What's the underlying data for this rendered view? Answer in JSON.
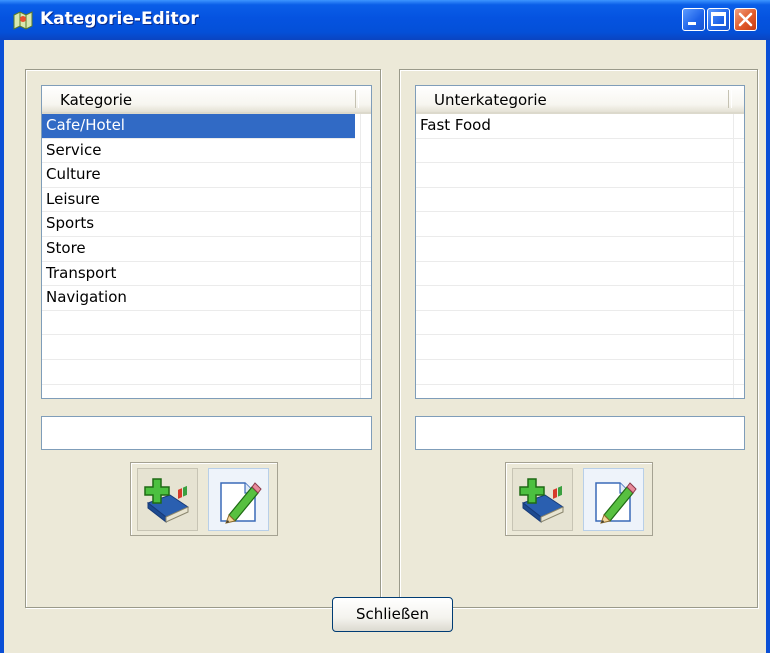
{
  "window": {
    "title": "Kategorie-Editor",
    "icon": "category-map-icon"
  },
  "title_buttons": [
    "minimize-icon",
    "maximize-icon",
    "close-icon"
  ],
  "left_panel": {
    "header": "Kategorie",
    "items": [
      "Cafe/Hotel",
      "Service",
      "Culture",
      "Leisure",
      "Sports",
      "Store",
      "Transport",
      "Navigation"
    ],
    "selected_index": 0,
    "input_value": "",
    "tools": [
      "add-book-icon",
      "edit-pencil-icon"
    ]
  },
  "right_panel": {
    "header": "Unterkategorie",
    "items": [
      "Fast Food"
    ],
    "input_value": "",
    "tools": [
      "add-book-icon",
      "edit-pencil-icon"
    ]
  },
  "footer": {
    "close_label": "Schließen"
  },
  "colors": {
    "titlebar": "#0553e0",
    "selection": "#316ac5",
    "client_bg": "#ece9d8"
  }
}
